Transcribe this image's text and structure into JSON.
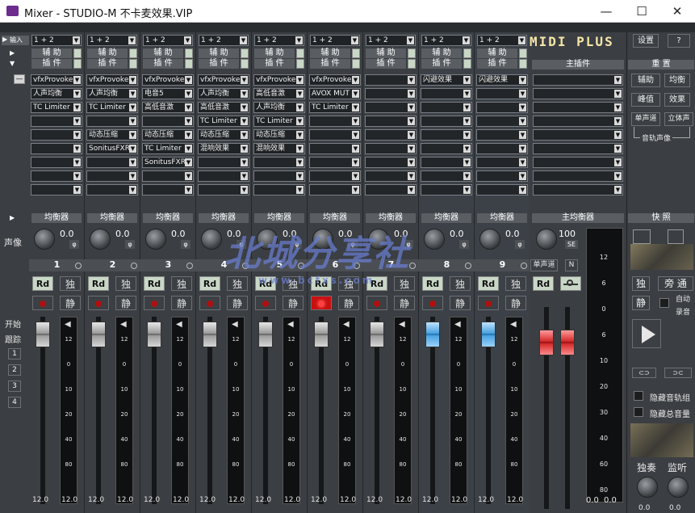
{
  "window": {
    "title": "Mixer - STUDIO-M 不卡麦效果.VIP",
    "minimize": "—",
    "maximize": "☐",
    "close": "✕"
  },
  "top_labels": {
    "input": "输入",
    "aux": "辅 助",
    "insert": "插 件",
    "main_insert": "主插件",
    "midi_plus": "MIDI PLUS",
    "settings": "设置",
    "help": "?",
    "reset": "重 置",
    "eq": "均衡器",
    "main_eq": "主均衡器",
    "snapshot": "快 照",
    "pan": "声像",
    "start": "开始",
    "track": "跟踪"
  },
  "channels": [
    {
      "num": "1",
      "input": "1 + 2",
      "plugins": [
        "vfxProvoke",
        "人声均衡",
        "TC Limiter",
        "",
        "",
        "",
        "",
        "",
        ""
      ],
      "pan": "0.0",
      "color": "normal",
      "rec_on": false
    },
    {
      "num": "2",
      "input": "1 + 2",
      "plugins": [
        "vfxProvoke",
        "人声均衡",
        "TC Limiter",
        "",
        "动态压缩",
        "SonitusFXR",
        "",
        "",
        ""
      ],
      "pan": "0.0",
      "color": "normal",
      "rec_on": false
    },
    {
      "num": "3",
      "input": "1 + 2",
      "plugins": [
        "vfxProvoke",
        "电音5",
        "高低音激",
        "",
        "动态压缩",
        "TC Limiter",
        "SonitusFXR",
        "",
        ""
      ],
      "pan": "0.0",
      "color": "normal",
      "rec_on": false
    },
    {
      "num": "4",
      "input": "1 + 2",
      "plugins": [
        "vfxProvoke",
        "人声均衡",
        "高低音激",
        "TC Limiter",
        "动态压缩",
        "混响效果",
        "",
        "",
        ""
      ],
      "pan": "0.0",
      "color": "normal",
      "rec_on": false
    },
    {
      "num": "5",
      "input": "1 + 2",
      "plugins": [
        "vfxProvoke",
        "高低音激",
        "人声均衡",
        "TC Limiter",
        "动态压缩",
        "混响效果",
        "",
        "",
        ""
      ],
      "pan": "0.0",
      "color": "normal",
      "rec_on": false
    },
    {
      "num": "6",
      "input": "1 + 2",
      "plugins": [
        "vfxProvoke",
        "AVOX MUT",
        "TC Limiter",
        "",
        "",
        "",
        "",
        "",
        ""
      ],
      "pan": "0.0",
      "color": "normal",
      "rec_on": true
    },
    {
      "num": "7",
      "input": "1 + 2",
      "plugins": [
        "",
        "",
        "",
        "",
        "",
        "",
        "",
        "",
        ""
      ],
      "pan": "0.0",
      "color": "normal",
      "rec_on": false
    },
    {
      "num": "8",
      "input": "1 + 2",
      "plugins": [
        "闪避效果",
        "",
        "",
        "",
        "",
        "",
        "",
        "",
        ""
      ],
      "pan": "0.0",
      "color": "blue",
      "rec_on": false
    },
    {
      "num": "9",
      "input": "1 + 2",
      "plugins": [
        "闪避效果",
        "",
        "",
        "",
        "",
        "",
        "",
        "",
        ""
      ],
      "pan": "0.0",
      "color": "blue",
      "rec_on": false
    }
  ],
  "channel_buttons": {
    "rd": "Rd",
    "solo": "独",
    "mute": "静"
  },
  "fader_scale": [
    "12",
    "0",
    "10",
    "20",
    "40",
    "80"
  ],
  "fader_value": "12.0",
  "main": {
    "pan": "100",
    "pan_mode": "SE",
    "mono": "单声道",
    "n": "N",
    "scale": [
      "12",
      "6",
      "0",
      "6",
      "10",
      "20",
      "30",
      "40",
      "60",
      "80"
    ],
    "readouts": [
      "0.0",
      "0.0"
    ]
  },
  "right_panel": {
    "aux": "辅助",
    "eq": "均衡",
    "peak": "峰值",
    "fx": "效果",
    "mono": "单声道",
    "stereo": "立体声",
    "track_pan": "音轨声像",
    "solo": "独",
    "bypass": "旁 通",
    "mute": "静",
    "auto_record_1": "自动",
    "auto_record_2": "录音",
    "hide_tracks": "隐藏音轨组",
    "hide_master": "隐藏总音量",
    "solo_label": "独奏",
    "monitor_label": "监听",
    "knob_values": [
      "0.0",
      "0.0"
    ]
  },
  "left_panel": {
    "tracks": [
      "1",
      "2",
      "3",
      "4"
    ],
    "collapse": "—"
  },
  "watermark": {
    "main": "北城分享社",
    "sub": "www.bcfxs.com"
  }
}
